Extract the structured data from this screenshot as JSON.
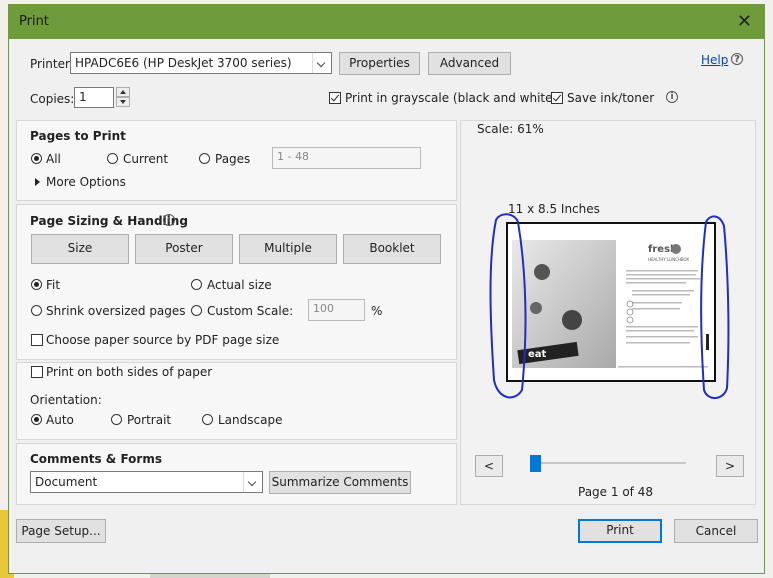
{
  "window": {
    "title": "Print"
  },
  "printer": {
    "label": "Printer:",
    "selected": "HPADC6E6 (HP DeskJet 3700 series)",
    "properties": "Properties",
    "advanced": "Advanced",
    "help": "Help"
  },
  "copies": {
    "label": "Copies:",
    "value": "1"
  },
  "options": {
    "grayscale": "Print in grayscale (black and white)",
    "grayscale_checked": true,
    "save_ink": "Save ink/toner",
    "save_ink_checked": true
  },
  "pages_to_print": {
    "title": "Pages to Print",
    "all": "All",
    "current": "Current",
    "pages": "Pages",
    "pages_placeholder": "1 - 48",
    "more_options": "More Options",
    "selected": "All"
  },
  "sizing": {
    "title": "Page Sizing & Handling",
    "tabs": [
      "Size",
      "Poster",
      "Multiple",
      "Booklet"
    ],
    "fit": "Fit",
    "actual_size": "Actual size",
    "shrink": "Shrink oversized pages",
    "custom_scale": "Custom Scale:",
    "custom_value": "100",
    "percent": "%",
    "paper_source": "Choose paper source by PDF page size",
    "selected": "Fit"
  },
  "duplex": {
    "label": "Print on both sides of paper"
  },
  "orientation": {
    "label": "Orientation:",
    "auto": "Auto",
    "portrait": "Portrait",
    "landscape": "Landscape",
    "selected": "Auto"
  },
  "comments": {
    "title": "Comments & Forms",
    "selected": "Document",
    "summarize": "Summarize Comments"
  },
  "preview": {
    "scale": "Scale:  61%",
    "paper_size": "11 x 8.5 Inches",
    "page_indicator": "Page 1 of 48",
    "prev": "<",
    "next": ">",
    "brand": "fresh",
    "headline": "HEALTHY LUNCHBOX",
    "word": "eat",
    "slider_fraction": 0.0
  },
  "footer": {
    "page_setup": "Page Setup...",
    "print": "Print",
    "cancel": "Cancel"
  },
  "colors": {
    "titlebar": "#6f9c3b",
    "accent": "#0078d7",
    "annotation": "#1f2fbf"
  }
}
